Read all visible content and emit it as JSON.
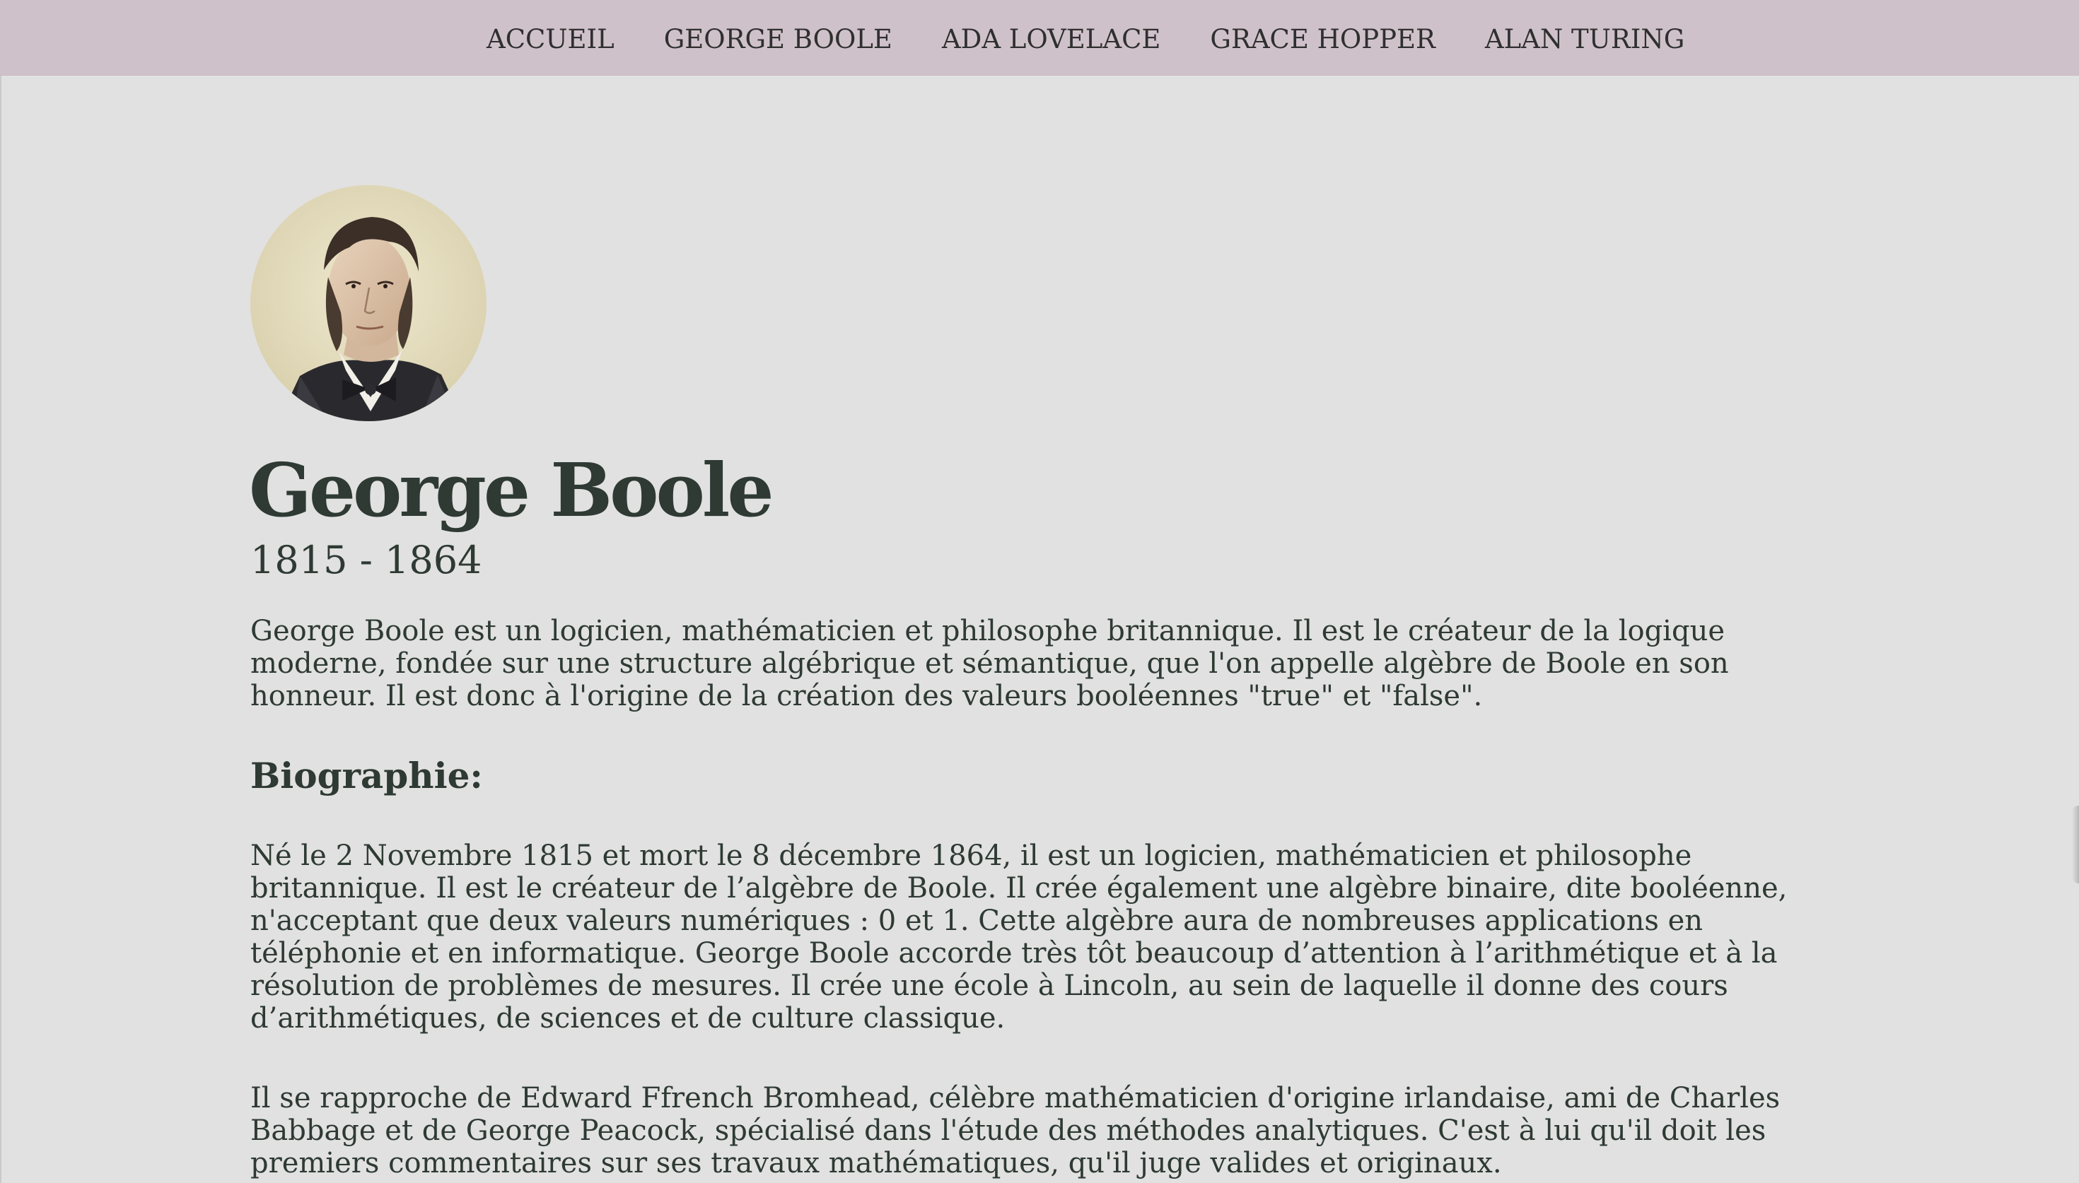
{
  "nav": {
    "items": [
      {
        "label": "ACCUEIL"
      },
      {
        "label": "GEORGE BOOLE"
      },
      {
        "label": "ADA LOVELACE"
      },
      {
        "label": "GRACE HOPPER"
      },
      {
        "label": "ALAN TURING"
      }
    ]
  },
  "profile": {
    "name": "George Boole",
    "dates": "1815 - 1864",
    "intro": "George Boole est un logicien, mathématicien et philosophe britannique. Il est le créateur de la logique moderne, fondée sur une structure algébrique et sémantique, que l'on appelle algèbre de Boole en son honneur. Il est donc à l'origine de la création des valeurs booléennes \"true\" et \"false\"."
  },
  "biography": {
    "heading": "Biographie:",
    "paragraphs": [
      "Né le 2 Novembre 1815 et mort le 8 décembre 1864, il est un logicien, mathématicien et philosophe britannique. Il est le créateur de l’algèbre de Boole. Il crée également une algèbre binaire, dite booléenne, n'acceptant que deux valeurs numériques : 0 et 1. Cette algèbre aura de nombreuses applications en téléphonie et en informatique. George Boole accorde très tôt beaucoup d’attention à l’arithmétique et à la résolution de problèmes de mesures. Il crée une école à Lincoln, au sein de laquelle il donne des cours d’arithmétiques, de sciences et de culture classique.",
      "Il se rapproche de Edward Ffrench Bromhead, célèbre mathématicien d'origine irlandaise, ami de Charles Babbage et de George Peacock, spécialisé dans l'étude des méthodes analytiques. C'est à lui qu'il doit les premiers commentaires sur ses travaux mathématiques, qu'il juge valides et originaux."
    ]
  },
  "colors": {
    "nav_background": "#cfc1ca",
    "page_background": "#e1e1e1",
    "text": "#2e3a33"
  }
}
